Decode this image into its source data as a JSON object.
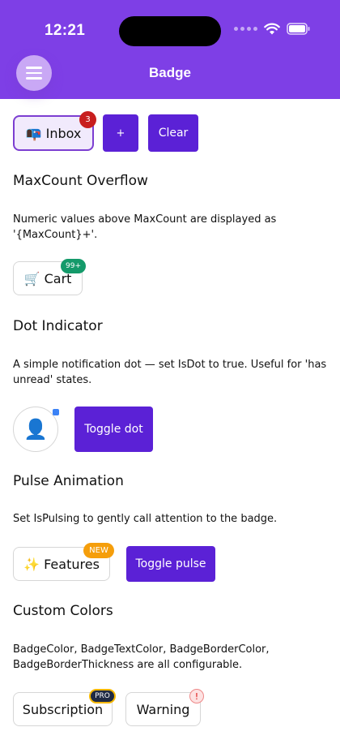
{
  "status_bar": {
    "time": "12:21"
  },
  "header": {
    "title": "Badge",
    "menu_icon": "hamburger-icon"
  },
  "inbox_row": {
    "inbox_label": "📭 Inbox",
    "inbox_badge": "3",
    "plus_label": "+",
    "clear_label": "Clear"
  },
  "maxcount": {
    "heading": "MaxCount Overflow",
    "description": "Numeric values above MaxCount are displayed as '{MaxCount}+'.",
    "cart_label": "🛒 Cart",
    "cart_badge": "99+"
  },
  "dot_indicator": {
    "heading": "Dot Indicator",
    "description": "A simple notification dot — set IsDot to true. Useful for 'has unread' states.",
    "avatar_glyph": "👤",
    "toggle_label": "Toggle dot"
  },
  "pulse": {
    "heading": "Pulse Animation",
    "description": "Set IsPulsing to gently call attention to the badge.",
    "features_label": "✨ Features",
    "features_badge": "NEW",
    "toggle_label": "Toggle pulse"
  },
  "custom_colors": {
    "heading": "Custom Colors",
    "description": "BadgeColor, BadgeTextColor, BadgeBorderColor, BadgeBorderThickness are all configurable.",
    "subscription_label": "Subscription",
    "subscription_badge": "PRO",
    "warning_label": "Warning",
    "warning_badge": "!"
  },
  "colors": {
    "header": "#7e3fe6",
    "primary_button": "#5b21d6",
    "inbox_badge": "#c81e1e",
    "cart_badge": "#149a6a",
    "new_badge": "#f59e0b",
    "pro_badge": "#1f2a44",
    "pro_badge_border": "#f5b700",
    "warning_badge_bg": "#fde2e2",
    "warning_badge_text": "#d11",
    "dot": "#3b82f6"
  }
}
